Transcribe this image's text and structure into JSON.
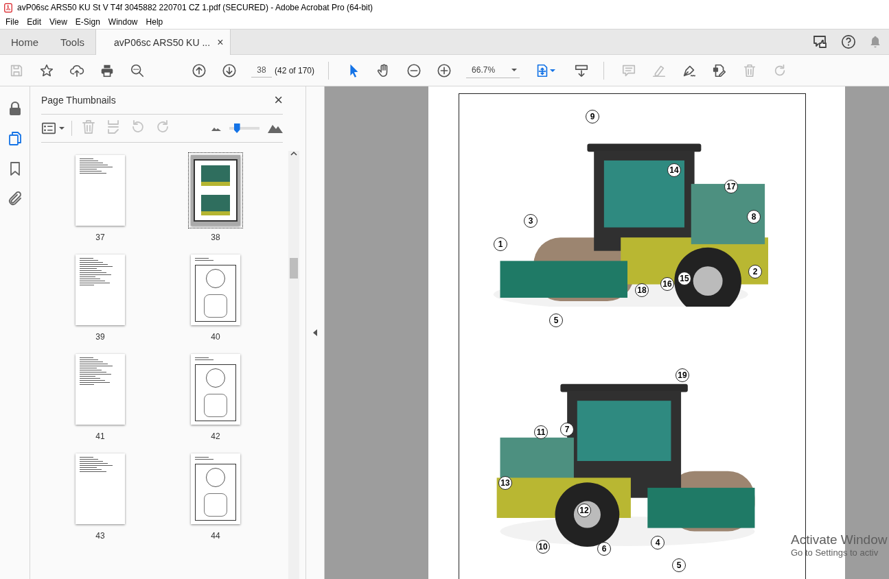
{
  "window": {
    "title": "avP06sc ARS50 KU St V T4f 3045882 220701 CZ 1.pdf (SECURED) - Adobe Acrobat Pro (64-bit)"
  },
  "menu": [
    "File",
    "Edit",
    "View",
    "E-Sign",
    "Window",
    "Help"
  ],
  "tabs": [
    {
      "label": "Home",
      "selected": false
    },
    {
      "label": "Tools",
      "selected": false
    },
    {
      "label": "avP06sc ARS50 KU ...",
      "selected": true,
      "close": "×"
    }
  ],
  "toolbar": {
    "left_tools": [
      {
        "kind": "save",
        "disabled": true
      },
      {
        "kind": "star",
        "disabled": false
      },
      {
        "kind": "upload",
        "disabled": false
      },
      {
        "kind": "print",
        "disabled": false
      },
      {
        "kind": "find",
        "disabled": false
      },
      {
        "kind": "prev",
        "disabled": false
      },
      {
        "kind": "next",
        "disabled": false
      }
    ],
    "page_number": "38",
    "page_count": "(42 of 170)",
    "mid_tools": [
      {
        "kind": "select",
        "selected": true
      },
      {
        "kind": "hand",
        "selected": false
      },
      {
        "kind": "zoomout",
        "selected": false
      },
      {
        "kind": "zoomin",
        "selected": false
      }
    ],
    "zoom": "66.7%",
    "right_tools": [
      {
        "kind": "organize",
        "disabled": false
      },
      {
        "kind": "scan",
        "disabled": false
      },
      {
        "kind": "comment",
        "disabled": true
      },
      {
        "kind": "highlight",
        "disabled": true
      },
      {
        "kind": "sign",
        "disabled": false
      },
      {
        "kind": "edit",
        "disabled": false
      },
      {
        "kind": "delete",
        "disabled": true
      },
      {
        "kind": "redo",
        "disabled": true
      }
    ]
  },
  "side_nav": [
    {
      "kind": "lock",
      "selected": false
    },
    {
      "kind": "pages",
      "selected": true
    },
    {
      "kind": "bookmark",
      "selected": false
    },
    {
      "kind": "attachment",
      "selected": false
    }
  ],
  "thumbnails_panel": {
    "title": "Page Thumbnails",
    "close": "×",
    "size_slider": {
      "level": 0.15
    },
    "tools": [
      {
        "kind": "delete",
        "disabled": true
      },
      {
        "kind": "extract",
        "disabled": true
      },
      {
        "kind": "rotate-left",
        "disabled": true
      },
      {
        "kind": "rotate-right",
        "disabled": true
      }
    ],
    "pages": [
      {
        "label": "37",
        "kind": "text",
        "selected": false
      },
      {
        "label": "38",
        "kind": "figure",
        "selected": true
      },
      {
        "label": "39",
        "kind": "list",
        "selected": false
      },
      {
        "label": "40",
        "kind": "diagram",
        "selected": false
      },
      {
        "label": "41",
        "kind": "list",
        "selected": false
      },
      {
        "label": "42",
        "kind": "diagram",
        "selected": false
      },
      {
        "label": "43",
        "kind": "text",
        "selected": false
      },
      {
        "label": "44",
        "kind": "diagram",
        "selected": false
      }
    ]
  },
  "document": {
    "figures": [
      {
        "callouts": [
          "9",
          "14",
          "17",
          "8",
          "3",
          "1",
          "2",
          "15",
          "16",
          "18",
          "5"
        ]
      },
      {
        "callouts": [
          "19",
          "11",
          "7",
          "13",
          "12",
          "10",
          "6",
          "4",
          "5"
        ]
      }
    ]
  },
  "os_notice": {
    "title": "Activate Window",
    "subtitle": "Go to Settings to activ"
  }
}
